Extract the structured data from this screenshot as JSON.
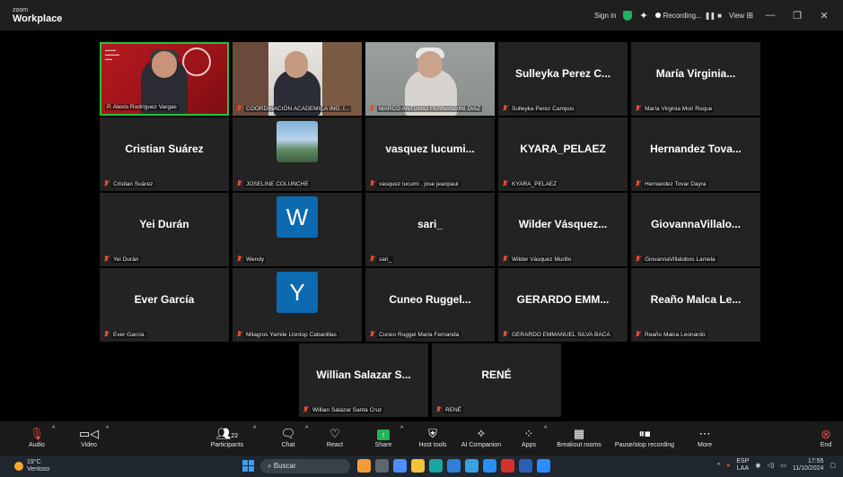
{
  "app": {
    "brand_small": "zoom",
    "brand_big": "Workplace"
  },
  "topbar": {
    "sign_in": "Sign in",
    "recording": "Recording...",
    "view": "View"
  },
  "tiles": [
    {
      "id": "t1",
      "display_name": "",
      "label": "P. Alexis Rodríguez Vargas",
      "muted": false,
      "kind": "camera1"
    },
    {
      "id": "t2",
      "display_name": "",
      "label": "COORDINACIÓN ACADEMICA ING. I...",
      "muted": true,
      "kind": "camera2"
    },
    {
      "id": "t3",
      "display_name": "",
      "label": "MARCO ANTONIO FERNANDINI DIAZ",
      "muted": true,
      "kind": "camera3"
    },
    {
      "id": "t4",
      "display_name": "Sulleyka Perez C...",
      "label": "Sulleyka Perez Campos",
      "muted": true,
      "kind": "name"
    },
    {
      "id": "t5",
      "display_name": "María Virginia...",
      "label": "María Virginia Mori Roque",
      "muted": true,
      "kind": "name"
    },
    {
      "id": "t6",
      "display_name": "Cristian Suárez",
      "label": "Cristian Suárez",
      "muted": true,
      "kind": "name"
    },
    {
      "id": "t7",
      "display_name": "",
      "label": "JOSELINE COLUNCHE",
      "muted": true,
      "kind": "photo"
    },
    {
      "id": "t8",
      "display_name": "vasquez  lucumi...",
      "label": "vasquez  lucumi . jose jeanpaul",
      "muted": true,
      "kind": "name"
    },
    {
      "id": "t9",
      "display_name": "KYARA_PELAEZ",
      "label": "KYARA_PELAEZ",
      "muted": true,
      "kind": "name"
    },
    {
      "id": "t10",
      "display_name": "Hernandez Tova...",
      "label": "Hernandez Tovar Dayra",
      "muted": true,
      "kind": "name"
    },
    {
      "id": "t11",
      "display_name": "Yei Durán",
      "label": "Yei Durán",
      "muted": true,
      "kind": "name"
    },
    {
      "id": "t12",
      "display_name": "W",
      "label": "Wendy",
      "muted": true,
      "kind": "avatar"
    },
    {
      "id": "t13",
      "display_name": "sari_",
      "label": "sari_",
      "muted": true,
      "kind": "name"
    },
    {
      "id": "t14",
      "display_name": "Wilder Vásquez...",
      "label": "Wilder Vásquez Murillo",
      "muted": true,
      "kind": "name"
    },
    {
      "id": "t15",
      "display_name": "GiovannaVillalo...",
      "label": "GiovannaVillalobos Lamela",
      "muted": true,
      "kind": "name"
    },
    {
      "id": "t16",
      "display_name": "Ever García",
      "label": "Ever García",
      "muted": true,
      "kind": "name"
    },
    {
      "id": "t17",
      "display_name": "Y",
      "label": "Milagros Yamile Llontop Cabanillas",
      "muted": true,
      "kind": "avatar"
    },
    {
      "id": "t18",
      "display_name": "Cuneo  Ruggel...",
      "label": "Cuneo Ruggel Maria Fernanda",
      "muted": true,
      "kind": "name"
    },
    {
      "id": "t19",
      "display_name": "GERARDO  EMM...",
      "label": "GERARDO EMMANUEL SILVA BACA",
      "muted": true,
      "kind": "name"
    },
    {
      "id": "t20",
      "display_name": "Reaño  Malca  Le...",
      "label": "Reaño Malca Leonardo",
      "muted": true,
      "kind": "name"
    },
    {
      "id": "t21",
      "display_name": "Willian Salazar S...",
      "label": "Willian Salazar Santa Cruz",
      "muted": true,
      "kind": "name"
    },
    {
      "id": "t22",
      "display_name": "RENÉ",
      "label": "RENÉ",
      "muted": true,
      "kind": "name"
    }
  ],
  "toolbar": {
    "audio": "Audio",
    "video": "Video",
    "participants": "Participants",
    "participants_count": "22",
    "chat": "Chat",
    "react": "React",
    "share": "Share",
    "host_tools": "Host tools",
    "ai_companion": "AI Companion",
    "apps": "Apps",
    "breakout_rooms": "Breakout rooms",
    "pause_recording": "Pause/stop recording",
    "more": "More",
    "end": "End"
  },
  "taskbar": {
    "temp": "19°C",
    "weather": "Ventoso",
    "search_placeholder": "Buscar",
    "lang_top": "ESP",
    "lang_bottom": "LAA",
    "time": "17:55",
    "date": "11/10/2024"
  },
  "colors": {
    "tile_bg": "#232323",
    "active_speaker": "#27c33b",
    "muted": "#e34a34",
    "avatar_blue": "#0c6bb0",
    "share_green": "#21b35b",
    "end_red": "#e5473b"
  }
}
